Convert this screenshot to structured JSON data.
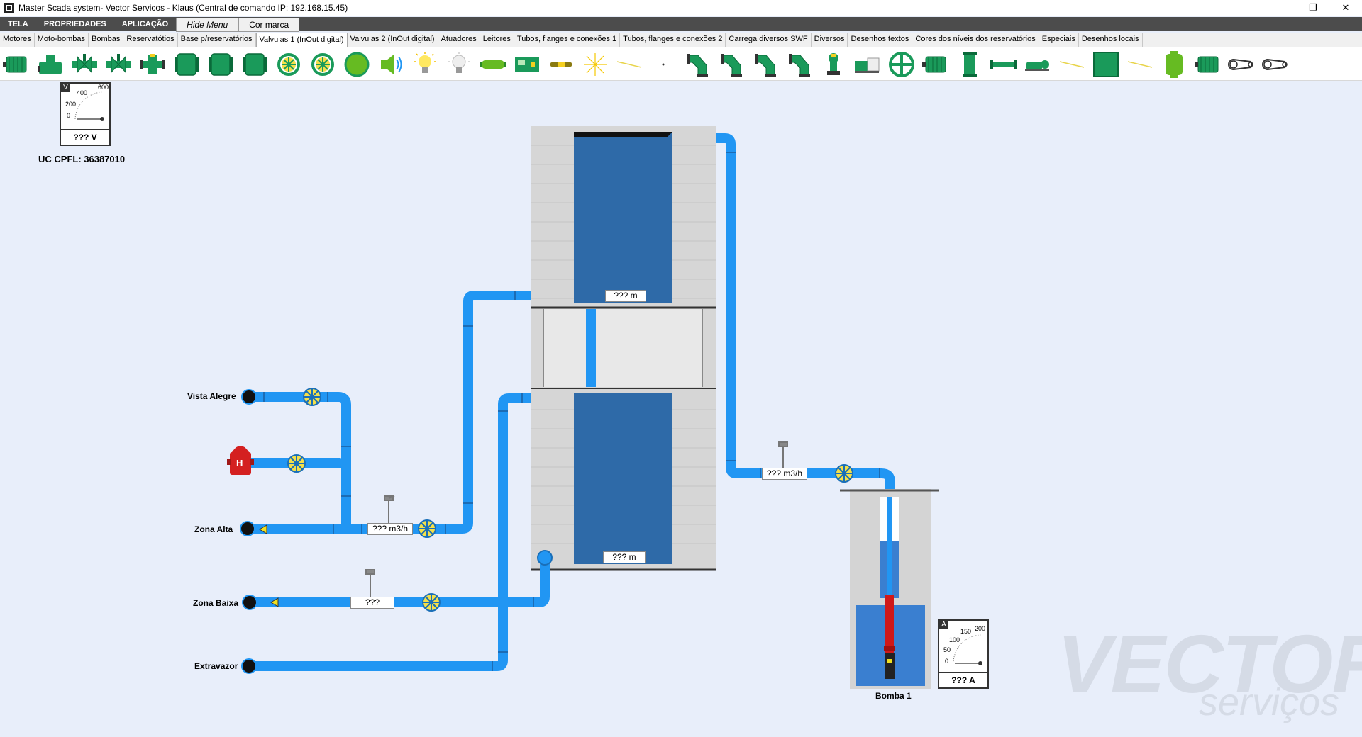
{
  "window": {
    "title": "Master Scada system- Vector Servicos - Klaus   (Central de comando IP: 192.168.15.45)",
    "minimize": "—",
    "restore": "❐",
    "close": "✕"
  },
  "menu": {
    "items": [
      "TELA",
      "PROPRIEDADES",
      "APLICAÇÃO"
    ],
    "hide_menu": "Hide Menu",
    "cor_marca": "Cor marca"
  },
  "tabs": [
    "Motores",
    "Moto-bombas",
    "Bombas",
    "Reservatótios",
    "Base p/reservatórios",
    "Valvulas 1 (InOut digital)",
    "Valvulas 2 (InOut digital)",
    "Atuadores",
    "Leitores",
    "Tubos, flanges e conexões 1",
    "Tubos, flanges e conexões 2",
    "Carrega diversos SWF",
    "Diversos",
    "Desenhos textos",
    "Cores dos níveis dos reservatórios",
    "Especiais",
    "Desenhos locais"
  ],
  "active_tab_index": 5,
  "colors": {
    "pipe": "#2196f3",
    "water": "#2e6aa8",
    "tank_gray": "#d4d4d4",
    "valve_yellow": "#f4e04a",
    "toolbar_green": "#1a9a5a",
    "hydrant_red": "#d42020",
    "pump_red": "#d01818"
  },
  "toolbar_icons": [
    "motor-icon",
    "motor-pump-icon",
    "valve-icon",
    "valve-icon",
    "flange-valve-icon",
    "gate-icon",
    "gate-icon",
    "gate-icon",
    "wheel-valve-icon",
    "wheel-valve-icon",
    "green-lamp-icon",
    "speaker-icon",
    "bulb-on-icon",
    "bulb-off-icon",
    "pump-body-icon",
    "panel-icon",
    "sensor-icon",
    "spark-icon",
    "line-icon",
    "dot-icon",
    "elbow-icon",
    "elbow-icon",
    "elbow-icon",
    "elbow-icon",
    "nozzle-icon",
    "compressor-icon",
    "handwheel-icon",
    "motor-icon",
    "filter-icon",
    "pipe-icon",
    "pump-icon",
    "line-icon",
    "green-square-icon",
    "line-icon",
    "tank-icon",
    "motor-icon",
    "belt-icon",
    "belt-icon"
  ],
  "voltmeter": {
    "letter": "V",
    "ticks": [
      "600",
      "400",
      "200",
      "0"
    ],
    "value": "??? V"
  },
  "uc_label": "UC CPFL: 36387010",
  "ammeter": {
    "letter": "A",
    "ticks": [
      "200",
      "150",
      "100",
      "50",
      "0"
    ],
    "value": "??? A"
  },
  "lines": {
    "vista_alegre": "Vista Alegre",
    "zona_alta": "Zona Alta",
    "zona_baixa": "Zona Baixa",
    "extravazor": "Extravazor",
    "hydrant_letter": "H"
  },
  "readouts": {
    "upper_level": "??? m",
    "lower_level": "??? m",
    "zona_alta_flow": "??? m3/h",
    "zona_baixa_flow": "???",
    "inlet_flow": "??? m3/h"
  },
  "pump_label": "Bomba 1",
  "watermark": {
    "brand": "VECTOR",
    "sub": "serviços"
  }
}
